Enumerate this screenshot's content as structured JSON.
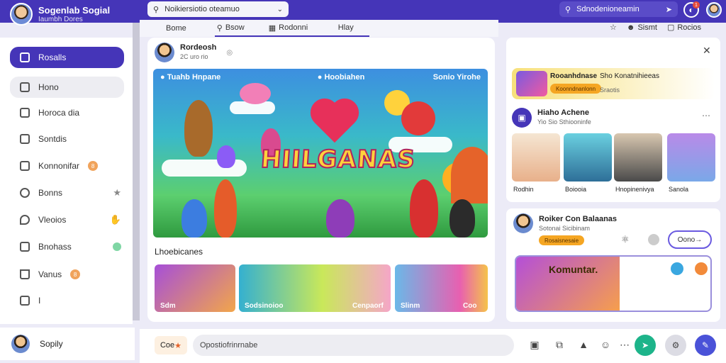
{
  "topbar": {
    "brand_name": "Sogenlab Sogial",
    "brand_sub": "Iaumbh Dores",
    "search_placeholder": "Noikiersiotio oteamuo",
    "right_search": "Sdnodenioneamin"
  },
  "tabs": [
    {
      "label": "Bome"
    },
    {
      "label": "Bsow"
    },
    {
      "label": "Rodonni"
    },
    {
      "label": "Hlay"
    }
  ],
  "header_right": {
    "item1": "Sismt",
    "item2": "Rocios"
  },
  "sidebar": {
    "items": [
      {
        "label": "Rosalls"
      },
      {
        "label": "Hono"
      },
      {
        "label": "Horoca dia"
      },
      {
        "label": "Sontdis"
      },
      {
        "label": "Konnonifar",
        "badge": "8"
      },
      {
        "label": "Bonns"
      },
      {
        "label": "Vleoios"
      },
      {
        "label": "Bnohass"
      },
      {
        "label": "Vanus",
        "badge": "8"
      },
      {
        "label": "I"
      }
    ],
    "footer_user": "Sopily"
  },
  "post": {
    "author": "Rordeosh",
    "meta": "2C uro  rio",
    "hero_left": "Tuahb Hnpane",
    "hero_mid": "Hoobiahen",
    "hero_right": "Sonio Yirohe",
    "hero_title": "HIILGANAS"
  },
  "section": {
    "title": "Lhoebicanes"
  },
  "thumbnails": [
    {
      "label": "Sdm"
    },
    {
      "label": "Sodsinoioo"
    },
    {
      "label": "Cenpaorf"
    },
    {
      "label": "Slinm"
    },
    {
      "label": "Coo"
    }
  ],
  "right": {
    "banner_title": "Rooanhdnase",
    "banner_side": "Sho Konatnihieeas",
    "banner_pill": "Koonndnanlonn",
    "banner_small": "Sraotis",
    "group_title": "Hiaho Achene",
    "group_sub": "Yio Sio Sthiooninfe",
    "photos": [
      {
        "label": "Rodhin"
      },
      {
        "label": "Boiooia"
      },
      {
        "label": "Hnopinenivya"
      },
      {
        "label": "Sanola"
      }
    ],
    "card2_title": "Roiker Con Balaanas",
    "card2_sub": "Sotonai Sicibinam",
    "card2_pill": "Rosaisnesaie",
    "card2_button": "Oono",
    "kom_title": "Komuntar."
  },
  "bottom": {
    "chip": "Coe",
    "composer_placeholder": "Opostiofrinrnabe"
  },
  "colors": {
    "accent": "#4535b8",
    "green": "#1db48a",
    "blue": "#4a52d8"
  }
}
